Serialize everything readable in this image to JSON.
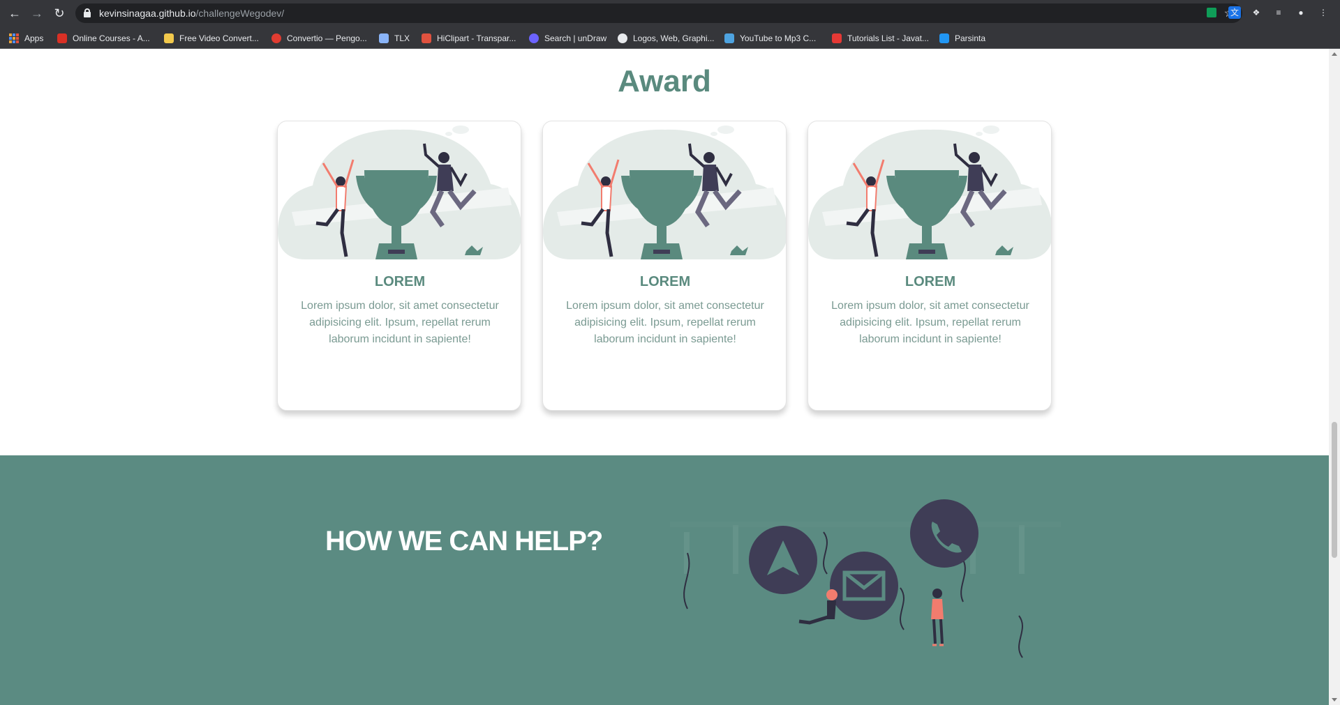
{
  "browser": {
    "url_host": "kevinsinagaa.github.io",
    "url_path": "/challengeWegodev/",
    "bookmarks": [
      {
        "label": "Apps",
        "color": "#e8a33d"
      },
      {
        "label": "Online Courses - A...",
        "color": "#d93025"
      },
      {
        "label": "Free Video Convert...",
        "color": "#f2c94c"
      },
      {
        "label": "Convertio — Pengo...",
        "color": "#e03c31"
      },
      {
        "label": "TLX",
        "color": "#8ab4f8"
      },
      {
        "label": "HiClipart - Transpar...",
        "color": "#e0523f"
      },
      {
        "label": "Search | unDraw",
        "color": "#6c63ff"
      },
      {
        "label": "Logos, Web, Graphi...",
        "color": "#e8eaed"
      },
      {
        "label": "YouTube to Mp3 C...",
        "color": "#4ea3e0"
      },
      {
        "label": "Tutorials List - Javat...",
        "color": "#e53935"
      },
      {
        "label": "Parsinta",
        "color": "#2196f3"
      }
    ]
  },
  "award": {
    "title": "Award",
    "cards": [
      {
        "title": "LOREM",
        "text": "Lorem ipsum dolor, sit amet consectetur adipisicing elit. Ipsum, repellat rerum laborum incidunt in sapiente!"
      },
      {
        "title": "LOREM",
        "text": "Lorem ipsum dolor, sit amet consectetur adipisicing elit. Ipsum, repellat rerum laborum incidunt in sapiente!"
      },
      {
        "title": "LOREM",
        "text": "Lorem ipsum dolor, sit amet consectetur adipisicing elit. Ipsum, repellat rerum laborum incidunt in sapiente!"
      }
    ]
  },
  "help": {
    "title": "HOW WE CAN HELP?"
  },
  "colors": {
    "accent": "#5a8a7e",
    "help_bg": "#5b8b82",
    "illustration_dark": "#3f3d56",
    "illustration_coral": "#f27c6e"
  },
  "icons": {
    "award_illustration": "trophy-celebration-illustration",
    "help_illustration": "contact-channels-illustration"
  }
}
